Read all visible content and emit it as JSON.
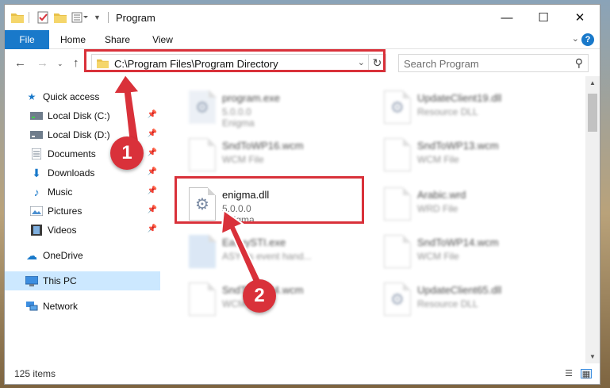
{
  "window": {
    "title": "Program",
    "controls": {
      "minimize": "—",
      "maximize": "☐",
      "close": "✕"
    }
  },
  "ribbon": {
    "tabs": [
      {
        "label": "File",
        "active": true
      },
      {
        "label": "Home"
      },
      {
        "label": "Share"
      },
      {
        "label": "View"
      }
    ],
    "help": "?"
  },
  "nav": {
    "address": "C:\\Program Files\\Program Directory",
    "search_placeholder": "Search Program"
  },
  "sidebar": {
    "items": [
      {
        "label": "Quick access",
        "icon": "star-icon"
      },
      {
        "label": "Local Disk (C:)",
        "icon": "drive-icon",
        "pinned": true
      },
      {
        "label": "Local Disk (D:)",
        "icon": "drive-icon",
        "pinned": true
      },
      {
        "label": "Documents",
        "icon": "documents-icon",
        "pinned": true
      },
      {
        "label": "Downloads",
        "icon": "downloads-icon",
        "pinned": true
      },
      {
        "label": "Music",
        "icon": "music-icon",
        "pinned": true
      },
      {
        "label": "Pictures",
        "icon": "pictures-icon",
        "pinned": true
      },
      {
        "label": "Videos",
        "icon": "videos-icon",
        "pinned": true
      },
      {
        "label": "OneDrive",
        "icon": "cloud-icon"
      },
      {
        "label": "This PC",
        "icon": "computer-icon",
        "selected": true
      },
      {
        "label": "Network",
        "icon": "network-icon"
      }
    ]
  },
  "files": [
    {
      "name": "program.exe",
      "line1": "5.0.0.0",
      "line2": "Enigma",
      "blurred": true
    },
    {
      "name": "UpdateClient19.dll",
      "line1": "Resource DLL",
      "blurred": true
    },
    {
      "name": "SndToWP16.wcm",
      "line1": "WCM File",
      "blurred": true
    },
    {
      "name": "SndToWP13.wcm",
      "line1": "WCM File",
      "blurred": true
    },
    {
      "name": "enigma.dll",
      "line1": "5.0.0.0",
      "line2": "Enigma",
      "blurred": false
    },
    {
      "name": "Arabic.wrd",
      "line1": "WRD File",
      "blurred": true
    },
    {
      "name": "EasyySTI.exe",
      "line1": "ASY ds event hand...",
      "blurred": true
    },
    {
      "name": "SndToWP14.wcm",
      "line1": "WCM File",
      "blurred": true
    },
    {
      "name": "SndToWP84.wcm",
      "line1": "WCM File",
      "blurred": true
    },
    {
      "name": "UpdateClient65.dll",
      "line1": "Resource DLL",
      "blurred": true
    }
  ],
  "status": {
    "count": "125 items"
  },
  "annotations": {
    "step1": "1",
    "step2": "2"
  },
  "colors": {
    "accent": "#1979ca",
    "highlight": "#d9313a",
    "selected": "#cce8ff"
  }
}
